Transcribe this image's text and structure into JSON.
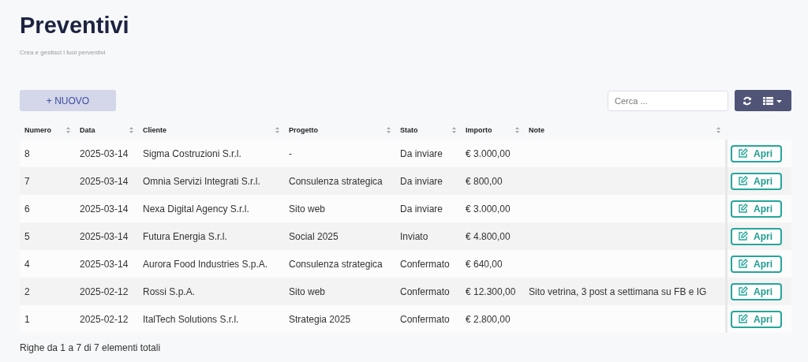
{
  "title": "Preventivi",
  "subtitle": "Crea e gestisci i tuoi perventivi",
  "new_button": "+ NUOVO",
  "search": {
    "placeholder": "Cerca ..."
  },
  "columns": [
    "Numero",
    "Data",
    "Cliente",
    "Progetto",
    "Stato",
    "Importo",
    "Note"
  ],
  "rows": [
    {
      "cells": [
        "8",
        "2025-03-14",
        "Sigma Costruzioni S.r.l.",
        "-",
        "Da inviare",
        "€ 3.000,00",
        ""
      ],
      "action": "Apri"
    },
    {
      "cells": [
        "7",
        "2025-03-14",
        "Omnia Servizi Integrati S.r.l.",
        "Consulenza strategica",
        "Da inviare",
        "€ 800,00",
        ""
      ],
      "action": "Apri"
    },
    {
      "cells": [
        "6",
        "2025-03-14",
        "Nexa Digital Agency S.r.l.",
        "Sito web",
        "Da inviare",
        "€ 3.000,00",
        ""
      ],
      "action": "Apri"
    },
    {
      "cells": [
        "5",
        "2025-03-14",
        "Futura Energia S.r.l.",
        "Social 2025",
        "Inviato",
        "€ 4.800,00",
        ""
      ],
      "action": "Apri"
    },
    {
      "cells": [
        "4",
        "2025-03-14",
        "Aurora Food Industries S.p.A.",
        "Consulenza strategica",
        "Confermato",
        "€ 640,00",
        ""
      ],
      "action": "Apri"
    },
    {
      "cells": [
        "2",
        "2025-02-12",
        "Rossi S.p.A.",
        "Sito web",
        "Confermato",
        "€ 12.300,00",
        "Sito vetrina, 3 post a settimana su FB e IG"
      ],
      "action": "Apri"
    },
    {
      "cells": [
        "1",
        "2025-02-12",
        "ItalTech Solutions S.r.l.",
        "Strategia 2025",
        "Confermato",
        "€ 2.800,00",
        ""
      ],
      "action": "Apri"
    }
  ],
  "footer": "Righe da 1 a 7 di 7 elementi totali"
}
